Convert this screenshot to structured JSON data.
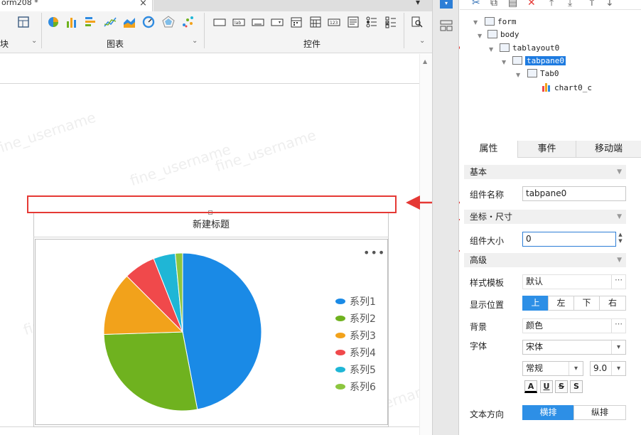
{
  "tab": {
    "title": "orm208 *",
    "close": "×",
    "menu": "▾"
  },
  "toolbar_groups": [
    {
      "label": "块"
    },
    {
      "label": "图表"
    },
    {
      "label": "控件"
    }
  ],
  "toolbar_icons": [
    "pie-chart-icon",
    "bar-chart-icon",
    "hbar-chart-icon",
    "line-chart-icon",
    "area-chart-icon",
    "gauge-chart-icon",
    "radar-chart-icon",
    "scatter-chart-icon",
    "textbox-icon",
    "label-icon",
    "button-icon",
    "dropdown-icon",
    "date-icon",
    "number-icon",
    "textarea-icon",
    "radio-group-icon",
    "checkbox-group-icon",
    "search-icon"
  ],
  "chart": {
    "title": "新建标题",
    "more": "•••"
  },
  "chart_data": {
    "type": "pie",
    "title": "新建标题",
    "categories": [
      "系列1",
      "系列2",
      "系列3",
      "系列4",
      "系列5",
      "系列6"
    ],
    "values": [
      47,
      27.5,
      13,
      6.5,
      4.5,
      1.5
    ],
    "colors": [
      "#1a8ae6",
      "#6fb21f",
      "#f2a21b",
      "#f0494b",
      "#1fb6d6",
      "#8cc63f"
    ],
    "legend": "right"
  },
  "tree": {
    "form": "form",
    "body": "body",
    "tablayout": "tablayout0",
    "tabpane": "tabpane0",
    "tab": "Tab0",
    "chart": "chart0_c"
  },
  "prop_tabs": [
    "属性",
    "事件",
    "移动端"
  ],
  "props": {
    "sec_basic": "基本",
    "name_label": "组件名称",
    "name_value": "tabpane0",
    "sec_coord": "坐标・尺寸",
    "size_label": "组件大小",
    "size_value": "0",
    "sec_adv": "高级",
    "style_label": "样式模板",
    "style_value": "默认",
    "pos_label": "显示位置",
    "pos_options": [
      "上",
      "左",
      "下",
      "右"
    ],
    "bg_label": "背景",
    "bg_value": "颜色",
    "font_label": "字体",
    "font_value": "宋体",
    "font_style": "常规",
    "font_size": "9.0",
    "text_dir_label": "文本方向",
    "text_dir_options": [
      "横排",
      "纵排"
    ],
    "dots": "⋯",
    "dd": "▾"
  },
  "watermark": "fine_username",
  "colors": {
    "accent": "#2d8fe6",
    "annotation": "#e53935",
    "selection": "#1e7be0"
  }
}
